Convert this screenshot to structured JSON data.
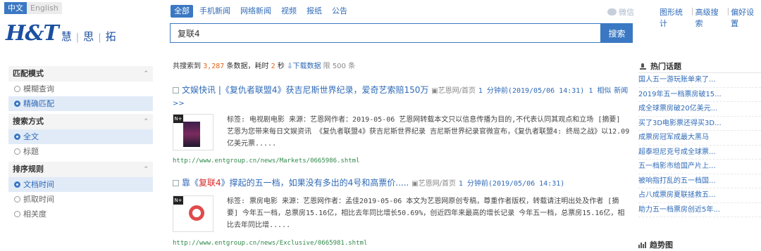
{
  "lang": {
    "active": "中文",
    "inactive": "English"
  },
  "logo": {
    "big": "H&T",
    "parts": [
      "慧",
      "思",
      "拓"
    ]
  },
  "tabs": [
    "全部",
    "手机新闻",
    "网络新闻",
    "视频",
    "报纸",
    "公告"
  ],
  "search": {
    "value": "复联4",
    "button": "搜索"
  },
  "weixin": "微信",
  "toplinks": [
    "图形统计",
    "高级搜索",
    "偏好设置"
  ],
  "sidebar": {
    "sections": [
      {
        "title": "匹配模式",
        "options": [
          {
            "label": "模糊查询",
            "selected": false
          },
          {
            "label": "精确匹配",
            "selected": true
          }
        ]
      },
      {
        "title": "搜索方式",
        "options": [
          {
            "label": "全文",
            "selected": true
          },
          {
            "label": "标题",
            "selected": false
          }
        ]
      },
      {
        "title": "排序规则",
        "options": [
          {
            "label": "文档时间",
            "selected": true
          },
          {
            "label": "抓取时间",
            "selected": false
          },
          {
            "label": "相关度",
            "selected": false
          }
        ]
      }
    ]
  },
  "summary": {
    "prefix": "共搜索到 ",
    "count": "3,287",
    "mid": " 条数据，耗时 ",
    "secs": "2",
    "suffix": " 秒",
    "download": "下载数据",
    "limit": "限 500 条"
  },
  "results": [
    {
      "title": "文娱快讯 |《复仇者联盟4》获吉尼斯世界纪录，爱奇艺索赔150万",
      "source": "艺恩网/首页",
      "meta": "1 分钟前(2019/05/06 14:31) 1 相似",
      "meta2": "新闻 >>",
      "snippet": "标签: 电视剧电影 来源：艺恩网作者：2019-05-06 艺恩网转载本文只以信息传播为目的,不代表认同其观点和立场 [摘要] 艺恩为您带来每日文娱资讯 《复仇者联盟4》获吉尼斯世界纪录 吉尼斯世界纪录官微宣布，《复仇者联盟4: 终局之战》以12.09亿美元票.....",
      "url": "http://www.entgroup.cn/news/Markets/0665986.shtml"
    },
    {
      "title_a": "靠《",
      "title_hl": "复联4",
      "title_b": "》撑起的五一档，如果没有多出的4号和高票价.....",
      "source": "艺恩网/首页",
      "meta": "1 分钟前(2019/05/06 14:31)",
      "snippet": "标签: 票房电影 来源：艺恩网作者：孟佳2019-05-06 本文为艺恩网原创专稿，尊重作者版权，转载请注明出处及作者 [摘要] 今年五一档，总票房15.16亿，相比去年同比增长50.69%，创近四年来最高的增长记录 今年五一档，总票房15.16亿，相比去年同比增.....",
      "url": "http://www.entgroup.cn/news/Exclusive/0665981.shtml"
    }
  ],
  "right": {
    "hot_title": "热门话题",
    "hot": [
      "国人五一游玩账单来了...",
      "2019年五一档票房破15...",
      "成全球票房破20亿美元...",
      "买了3D电影票还得买3D...",
      "成票房冠军成最大黑马",
      "超泰坦尼克号成全球票...",
      "五一档影市给国产片上...",
      "被响指打乱的五一档国...",
      "占八成票房夏联拯救五...",
      "助力五一档票房创近5年..."
    ],
    "trend_title": "趋势图"
  }
}
